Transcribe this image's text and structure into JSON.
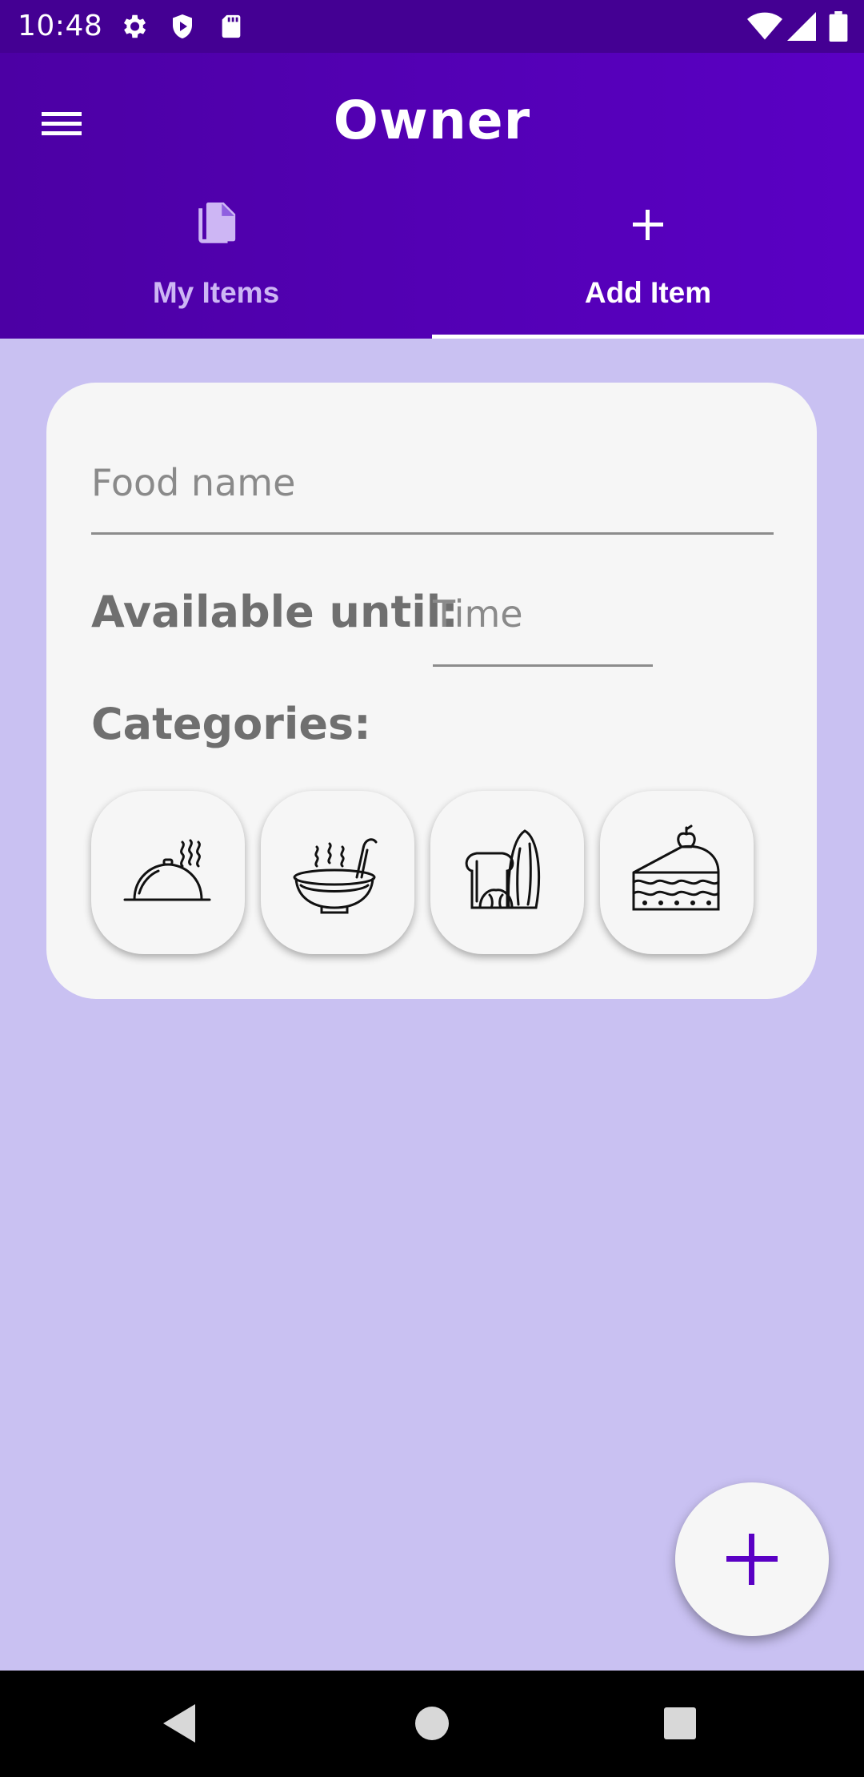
{
  "status_bar": {
    "time": "10:48",
    "icons": [
      "gear-icon",
      "shield-icon",
      "sd-card-icon",
      "wifi-icon",
      "cell-signal-icon",
      "battery-icon"
    ]
  },
  "app_bar": {
    "title": "Owner",
    "menu_icon": "hamburger-menu-icon"
  },
  "tabs": [
    {
      "label": "My Items",
      "icon": "documents-icon",
      "selected": false
    },
    {
      "label": "Add Item",
      "icon": "plus-icon",
      "selected": true
    }
  ],
  "form": {
    "food_name_placeholder": "Food name",
    "available_until_label": "Available until:",
    "time_placeholder": "Time",
    "categories_label": "Categories:",
    "categories": [
      {
        "icon": "serving-dish-icon"
      },
      {
        "icon": "soup-bowl-icon"
      },
      {
        "icon": "bread-icon"
      },
      {
        "icon": "cake-slice-icon"
      }
    ]
  },
  "fab": {
    "icon": "plus-icon"
  },
  "nav_bar": {
    "icons": [
      "back-icon",
      "home-icon",
      "recents-icon"
    ]
  },
  "colors": {
    "primary": "#5500bb",
    "status_bar": "#440093",
    "background": "#c9c1f2",
    "card": "#f6f6f6",
    "accent": "#5a00c4"
  }
}
